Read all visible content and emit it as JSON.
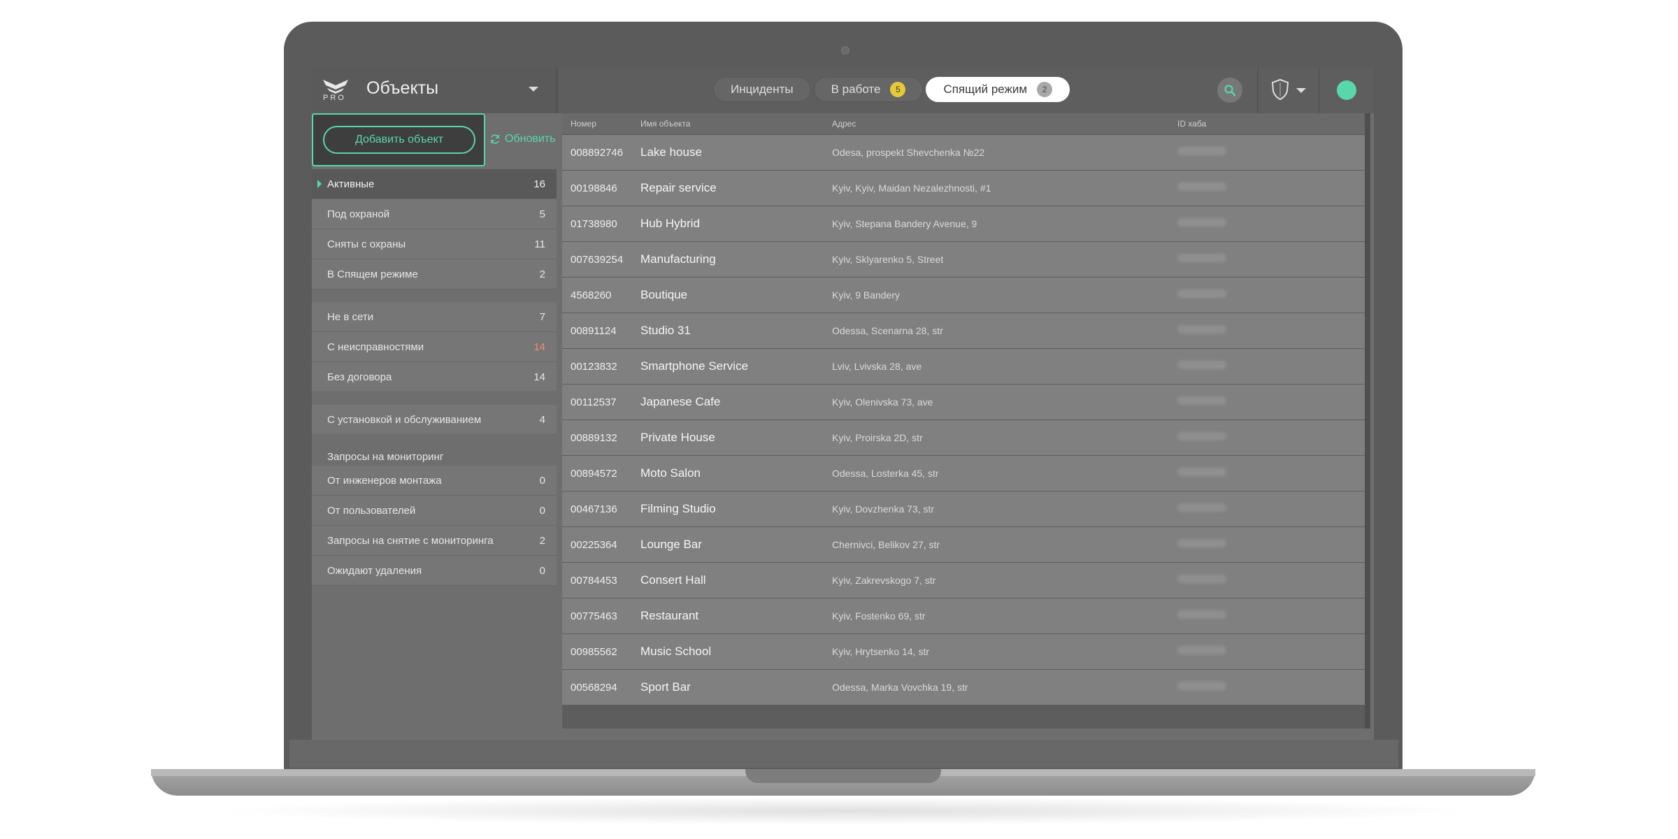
{
  "header": {
    "logo_text": "PRO",
    "title": "Объекты",
    "tabs": [
      {
        "label": "Инциденты",
        "badge": "",
        "active": false
      },
      {
        "label": "В работе",
        "badge": "5",
        "active": false
      },
      {
        "label": "Спящий режим",
        "badge": "2",
        "active": true
      }
    ],
    "status_color": "#59d7aa"
  },
  "sidebar": {
    "add_button": "Добавить объект",
    "refresh_label": "Обновить",
    "group1": [
      {
        "label": "Активные",
        "count": "16"
      },
      {
        "label": "Под охраной",
        "count": "5"
      },
      {
        "label": "Сняты с охраны",
        "count": "11"
      },
      {
        "label": "В Спящем режиме",
        "count": "2"
      }
    ],
    "group2": [
      {
        "label": "Не в сети",
        "count": "7"
      },
      {
        "label": "С неисправностями",
        "count": "14"
      },
      {
        "label": "Без договора",
        "count": "14"
      }
    ],
    "group3": [
      {
        "label": "С установкой и обслуживанием",
        "count": "4"
      }
    ],
    "requests_header": "Запросы на мониторинг",
    "group4": [
      {
        "label": "От инженеров монтажа",
        "count": "0"
      },
      {
        "label": "От пользователей",
        "count": "0"
      },
      {
        "label": "Запросы на снятие с мониторинга",
        "count": "2"
      },
      {
        "label": "Ожидают удаления",
        "count": "0"
      }
    ]
  },
  "table": {
    "columns": [
      "Номер",
      "Имя объекта",
      "Адрес",
      "ID хаба"
    ],
    "rows": [
      {
        "number": "008892746",
        "name": "Lake house",
        "address": "Odesa, prospekt Shevchenka №22"
      },
      {
        "number": "00198846",
        "name": "Repair service",
        "address": "Kyiv, Kyiv, Maidan Nezalezhnosti, #1"
      },
      {
        "number": "01738980",
        "name": "Hub Hybrid",
        "address": "Kyiv, Stepana Bandery Avenue, 9"
      },
      {
        "number": "007639254",
        "name": "Manufacturing",
        "address": "Kyiv, Sklyarenko 5, Street"
      },
      {
        "number": "4568260",
        "name": "Boutique",
        "address": "Kyiv, 9 Bandery"
      },
      {
        "number": "00891124",
        "name": "Studio 31",
        "address": "Odessa, Scenarna 28, str"
      },
      {
        "number": "00123832",
        "name": "Smartphone Service",
        "address": "Lviv, Lvivska 28, ave"
      },
      {
        "number": "00112537",
        "name": "Japanese Cafe",
        "address": "Kyiv, Olenivska 73, ave"
      },
      {
        "number": "00889132",
        "name": "Private House",
        "address": "Kyiv, Proirska 2D, str"
      },
      {
        "number": "00894572",
        "name": "Moto Salon",
        "address": "Odessa, Losterka 45, str"
      },
      {
        "number": "00467136",
        "name": "Filming Studio",
        "address": "Kyiv, Dovzhenka 73, str"
      },
      {
        "number": "00225364",
        "name": "Lounge Bar",
        "address": "Chernivci, Belikov 27, str"
      },
      {
        "number": "00784453",
        "name": "Consert Hall",
        "address": "Kyiv, Zakrevskogo 7, str"
      },
      {
        "number": "00775463",
        "name": "Restaurant",
        "address": "Kyiv, Fostenko 69, str"
      },
      {
        "number": "00985562",
        "name": "Music School",
        "address": "Kyiv, Hrytsenko 14, str"
      },
      {
        "number": "00568294",
        "name": "Sport Bar",
        "address": "Odessa, Marka Vovchka 19, str"
      }
    ]
  }
}
